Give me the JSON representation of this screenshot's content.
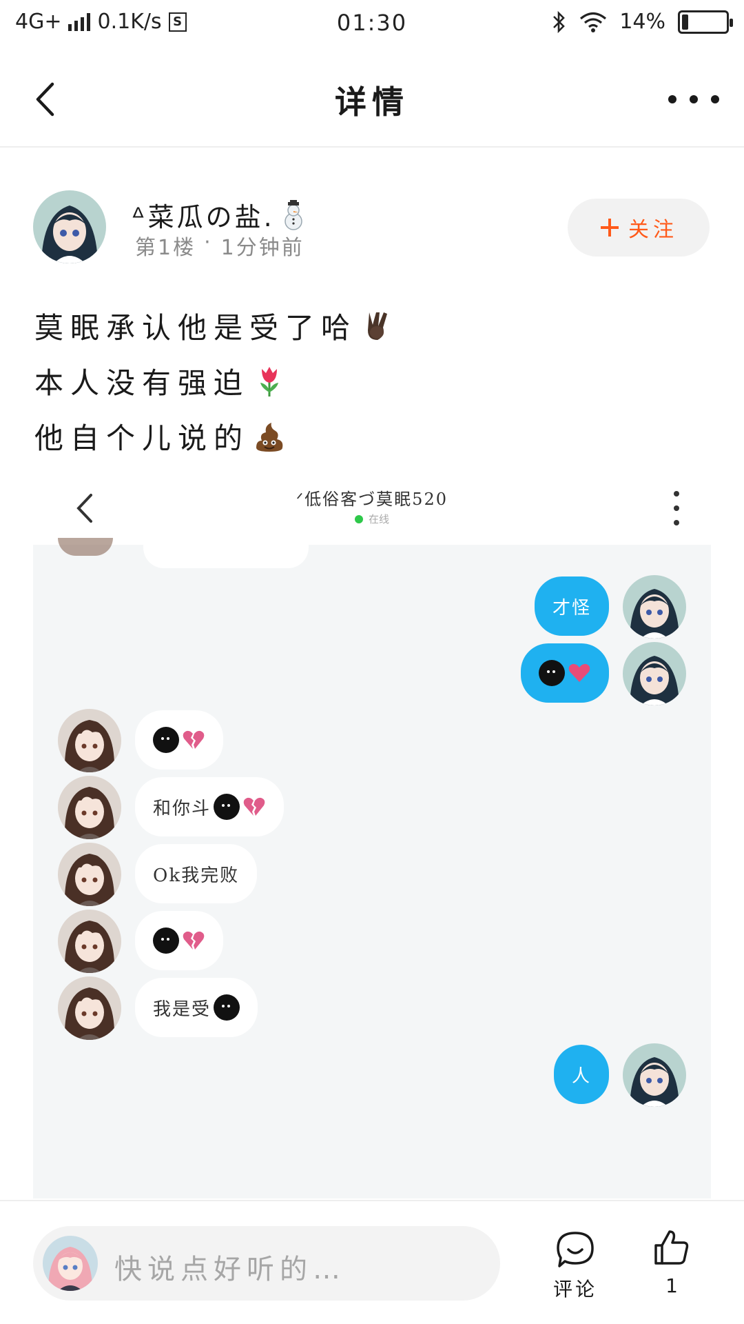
{
  "status_bar": {
    "network": "4G+",
    "speed": "0.1K/s",
    "sim_label": "S",
    "time": "01:30",
    "battery": "14%",
    "battery_level": 0.14
  },
  "header": {
    "title": "详情",
    "back_icon": "chevron-left-icon",
    "more_icon": "more-horizontal-icon"
  },
  "post": {
    "username": "ᐞ菜瓜の盐.",
    "username_emoji": "snowman-emoji",
    "floor": "第1楼",
    "separator": "·",
    "time_ago": "1分钟前",
    "follow_label": "关注",
    "lines": [
      {
        "text": "莫眠承认他是受了哈",
        "emoji": "victory-hand-emoji"
      },
      {
        "text": "本人没有强迫",
        "emoji": "tulip-emoji"
      },
      {
        "text": "他自个儿说的",
        "emoji": "poo-emoji"
      }
    ]
  },
  "chat_screenshot": {
    "title": "ᐟ低俗客づ莫眠520",
    "status": "在线",
    "messages": [
      {
        "side": "me",
        "text": "才怪",
        "emojis": []
      },
      {
        "side": "me",
        "text": "",
        "emojis": [
          "black-face",
          "heart"
        ]
      },
      {
        "side": "them",
        "text": "",
        "emojis": [
          "black-face",
          "broken-heart"
        ]
      },
      {
        "side": "them",
        "text": "和你斗",
        "emojis": [
          "black-face",
          "broken-heart"
        ]
      },
      {
        "side": "them",
        "text": "Ok我完败",
        "emojis": []
      },
      {
        "side": "them",
        "text": "",
        "emojis": [
          "black-face",
          "broken-heart"
        ]
      },
      {
        "side": "them",
        "text": "我是受",
        "emojis": [
          "black-face"
        ]
      },
      {
        "side": "me",
        "text": "人",
        "emojis": []
      }
    ]
  },
  "bottom_bar": {
    "placeholder": "快说点好听的…",
    "comment_label": "评论",
    "like_count": "1"
  },
  "colors": {
    "accent": "#ff5a1a",
    "chat_bubble_me": "#1fb1f0",
    "chat_bg": "#f4f6f7",
    "online": "#2ec84a"
  }
}
